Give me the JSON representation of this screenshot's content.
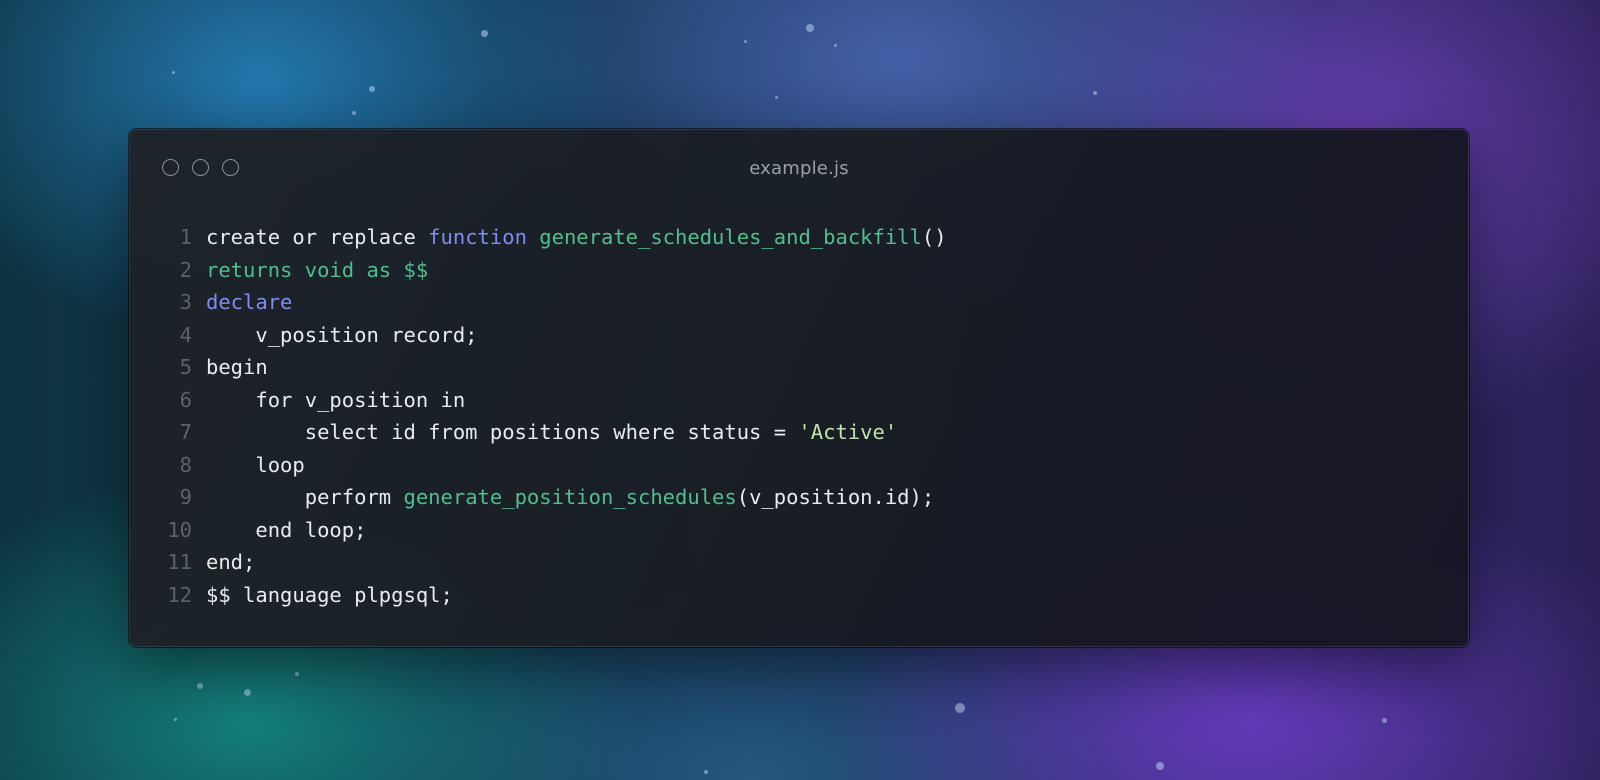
{
  "window": {
    "title": "example.js"
  },
  "colors": {
    "plain": "#e9ebee",
    "keyword": "#7f8cf0",
    "function": "#4fbf8e",
    "string": "#bfe3a8",
    "line_number": "#5d6269"
  },
  "icons": {
    "close": "circle-outline",
    "minimize": "circle-outline",
    "maximize": "circle-outline"
  },
  "code": {
    "lines": [
      {
        "n": "1",
        "tokens": [
          {
            "t": "create or replace ",
            "c": "plain"
          },
          {
            "t": "function",
            "c": "keyword"
          },
          {
            "t": " ",
            "c": "plain"
          },
          {
            "t": "generate_schedules_and_backfill",
            "c": "fn"
          },
          {
            "t": "()",
            "c": "plain"
          }
        ]
      },
      {
        "n": "2",
        "tokens": [
          {
            "t": "returns void as $$",
            "c": "fn"
          }
        ]
      },
      {
        "n": "3",
        "tokens": [
          {
            "t": "declare",
            "c": "keyword"
          }
        ]
      },
      {
        "n": "4",
        "tokens": [
          {
            "t": "    v_position record;",
            "c": "plain"
          }
        ]
      },
      {
        "n": "5",
        "tokens": [
          {
            "t": "begin",
            "c": "plain"
          }
        ]
      },
      {
        "n": "6",
        "tokens": [
          {
            "t": "    for v_position in",
            "c": "plain"
          }
        ]
      },
      {
        "n": "7",
        "tokens": [
          {
            "t": "        select id from positions where status = ",
            "c": "plain"
          },
          {
            "t": "'Active'",
            "c": "string"
          }
        ]
      },
      {
        "n": "8",
        "tokens": [
          {
            "t": "    loop",
            "c": "plain"
          }
        ]
      },
      {
        "n": "9",
        "tokens": [
          {
            "t": "        perform ",
            "c": "plain"
          },
          {
            "t": "generate_position_schedules",
            "c": "fn"
          },
          {
            "t": "(v_position.id);",
            "c": "plain"
          }
        ]
      },
      {
        "n": "10",
        "tokens": [
          {
            "t": "    end loop;",
            "c": "plain"
          }
        ]
      },
      {
        "n": "11",
        "tokens": [
          {
            "t": "end;",
            "c": "plain"
          }
        ]
      },
      {
        "n": "12",
        "tokens": [
          {
            "t": "$$ language plpgsql;",
            "c": "plain"
          }
        ]
      }
    ]
  }
}
